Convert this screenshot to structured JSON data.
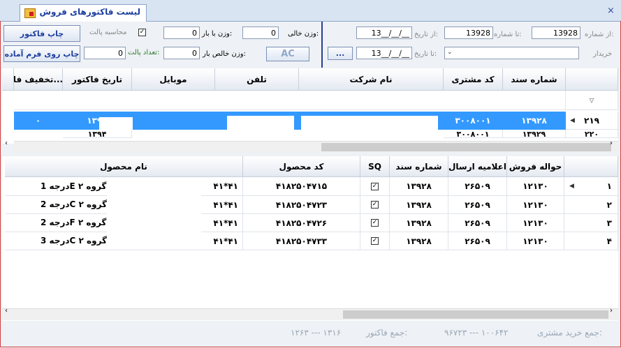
{
  "tab": {
    "title": "لیست فاکتورهای فروش",
    "close": "×"
  },
  "filters": {
    "from_number_label": "از شماره:",
    "from_number": "13928",
    "to_number_label": "تا شماره:",
    "to_number": "13928",
    "from_date_label": "از تاریخ:",
    "from_date": "13__/__/__",
    "to_date_label": "تا تاریخ:",
    "to_date": "13__/__/__",
    "buyer_label": "خریدار",
    "buyer_value": "",
    "empty_weight_label": "وزن خالی:",
    "empty_weight": "0",
    "loaded_weight_label": "وزن با بار:",
    "loaded_weight": "0",
    "net_weight_label": "وزن خالص بار:",
    "net_weight": "0",
    "pallet_count_label": "تعداد پالت:",
    "pallet_count": "0",
    "pallet_calc_label": "محاسبه پالت",
    "ellipsis_button": "...",
    "ac_button": "AC",
    "print_invoice_button": "چاپ فاکتور",
    "print_form_button": "چاپ روی فرم آماده"
  },
  "top_grid": {
    "columns": [
      "شماره سند",
      "کد مشتری",
      "نام شرکت",
      "تلفن",
      "موبایل",
      "تاریخ فاکتور",
      "تخفیف فا..."
    ],
    "rows": [
      {
        "index": "۲۱۹",
        "doc": "۱۳۹۲۸",
        "customer": "۳۰۰۸۰۰۱",
        "date": "۱۳۹۴",
        "discount": "۰"
      },
      {
        "index": "۲۲۰",
        "doc": "۱۳۹۲۹",
        "customer": "۳۰۰۸۰۰۱",
        "date": "۱۳۹۴",
        "discount": ""
      }
    ]
  },
  "bottom_grid": {
    "columns": [
      "حواله فروش",
      "اعلامیه ارسال",
      "شماره سند",
      "SQ",
      "کد محصول",
      "نام محصول"
    ],
    "rows": [
      {
        "index": "۱",
        "transfer": "۱۲۱۳۰",
        "notice": "۲۶۵۰۹",
        "doc": "۱۳۹۲۸",
        "sq": true,
        "code": "۴۱۸۲۵۰۴۷۱۵",
        "name_right": "۴۱*۴۱",
        "name_left": "درجه 1E گروه ۲"
      },
      {
        "index": "۲",
        "transfer": "۱۲۱۳۰",
        "notice": "۲۶۵۰۹",
        "doc": "۱۳۹۲۸",
        "sq": true,
        "code": "۴۱۸۲۵۰۴۷۲۳",
        "name_right": "۴۱*۴۱",
        "name_left": "درجه 2C گروه ۲"
      },
      {
        "index": "۳",
        "transfer": "۱۲۱۳۰",
        "notice": "۲۶۵۰۹",
        "doc": "۱۳۹۲۸",
        "sq": true,
        "code": "۴۱۸۲۵۰۴۷۲۶",
        "name_right": "۴۱*۴۱",
        "name_left": "درجه 2F گروه ۲"
      },
      {
        "index": "۴",
        "transfer": "۱۲۱۳۰",
        "notice": "۲۶۵۰۹",
        "doc": "۱۳۹۲۸",
        "sq": true,
        "code": "۴۱۸۲۵۰۴۷۳۳",
        "name_right": "۴۱*۴۱",
        "name_left": "درجه 3C گروه ۲"
      }
    ]
  },
  "footer": {
    "customer_total_label": "جمع خرید مشتری:",
    "customer_total": "۹۶۷۲۳ --- ۱۰۰۶۴۲",
    "invoice_total_label": "جمع فاکتور:",
    "invoice_total": "۱۲۶۳ --- ۱۳۱۶"
  }
}
